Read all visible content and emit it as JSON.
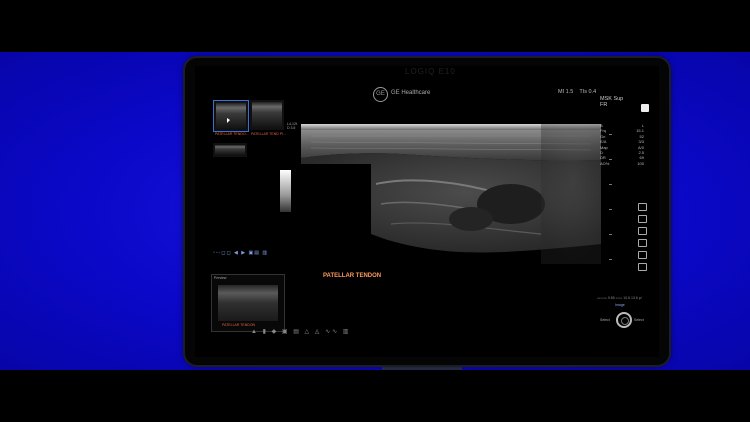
{
  "device": {
    "ghost_title": "LOGIQ E10",
    "brand": "GE Healthcare",
    "logo_text": "GE",
    "mi": "MI 1.5",
    "tis": "TIs 0.4",
    "preset": "MSK Sup",
    "preset_sub": "FR"
  },
  "thumbnails": [
    {
      "label": "PATELLAR TENDO..."
    },
    {
      "label": "PATELLAR TEND PI..."
    },
    {
      "label": ""
    }
  ],
  "controls_text": "▫◦◦◻◻ ◀ ▶ ▣▤ ▥",
  "preview": {
    "title": "Preview",
    "label": "PATELLAR TENDON"
  },
  "image_label": "PATELLAR TENDON",
  "us_label": "L4-12t\nD 3.5",
  "parameters": [
    {
      "k": "B",
      "v": "L"
    },
    {
      "k": "Frq",
      "v": "15.1"
    },
    {
      "k": "Gn",
      "v": "52"
    },
    {
      "k": "E/A",
      "v": "3/3"
    },
    {
      "k": "Map",
      "v": "A/0"
    },
    {
      "k": "D",
      "v": "2.5"
    },
    {
      "k": "DR",
      "v": "69"
    },
    {
      "k": "AO%",
      "v": "100"
    }
  ],
  "bottom_status": "▭▭▭ 9.85 ▭▭ 10.6 13.6 p/",
  "knob": {
    "top": "Image",
    "left": "Select",
    "right": "Select"
  },
  "colors": {
    "background": "#0b08c9",
    "accent": "#e8643c"
  }
}
